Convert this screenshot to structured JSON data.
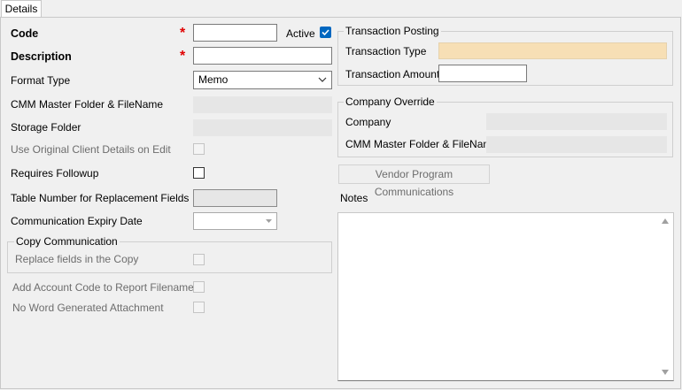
{
  "tabs": {
    "details": "Details"
  },
  "left": {
    "code_label": "Code",
    "required_mark": "*",
    "code_value": "",
    "active_label": "Active",
    "active_checked": true,
    "description_label": "Description",
    "description_value": "",
    "format_type_label": "Format Type",
    "format_type_value": "Memo",
    "cmm_master_label": "CMM Master Folder & FileName",
    "storage_folder_label": "Storage Folder",
    "use_original_label": "Use Original Client Details on Edit",
    "requires_followup_label": "Requires Followup",
    "table_number_label": "Table Number for Replacement Fields",
    "expiry_date_label": "Communication Expiry Date",
    "copy_group_label": "Copy Communication",
    "replace_fields_label": "Replace fields in the Copy",
    "add_account_code_label": "Add Account Code to Report Filenames",
    "no_word_label": "No Word Generated Attachment"
  },
  "right": {
    "transaction_posting_label": "Transaction Posting",
    "transaction_type_label": "Transaction Type",
    "transaction_amount_label": "Transaction Amount",
    "company_override_label": "Company Override",
    "company_label": "Company",
    "cmm_master_label": "CMM Master Folder & FileName",
    "vendor_button_label": "Vendor Program Communications",
    "notes_label": "Notes"
  },
  "colors": {
    "accent": "#0067c0",
    "required": "#e00000",
    "transaction_type_fill": "#f7dfb5"
  }
}
